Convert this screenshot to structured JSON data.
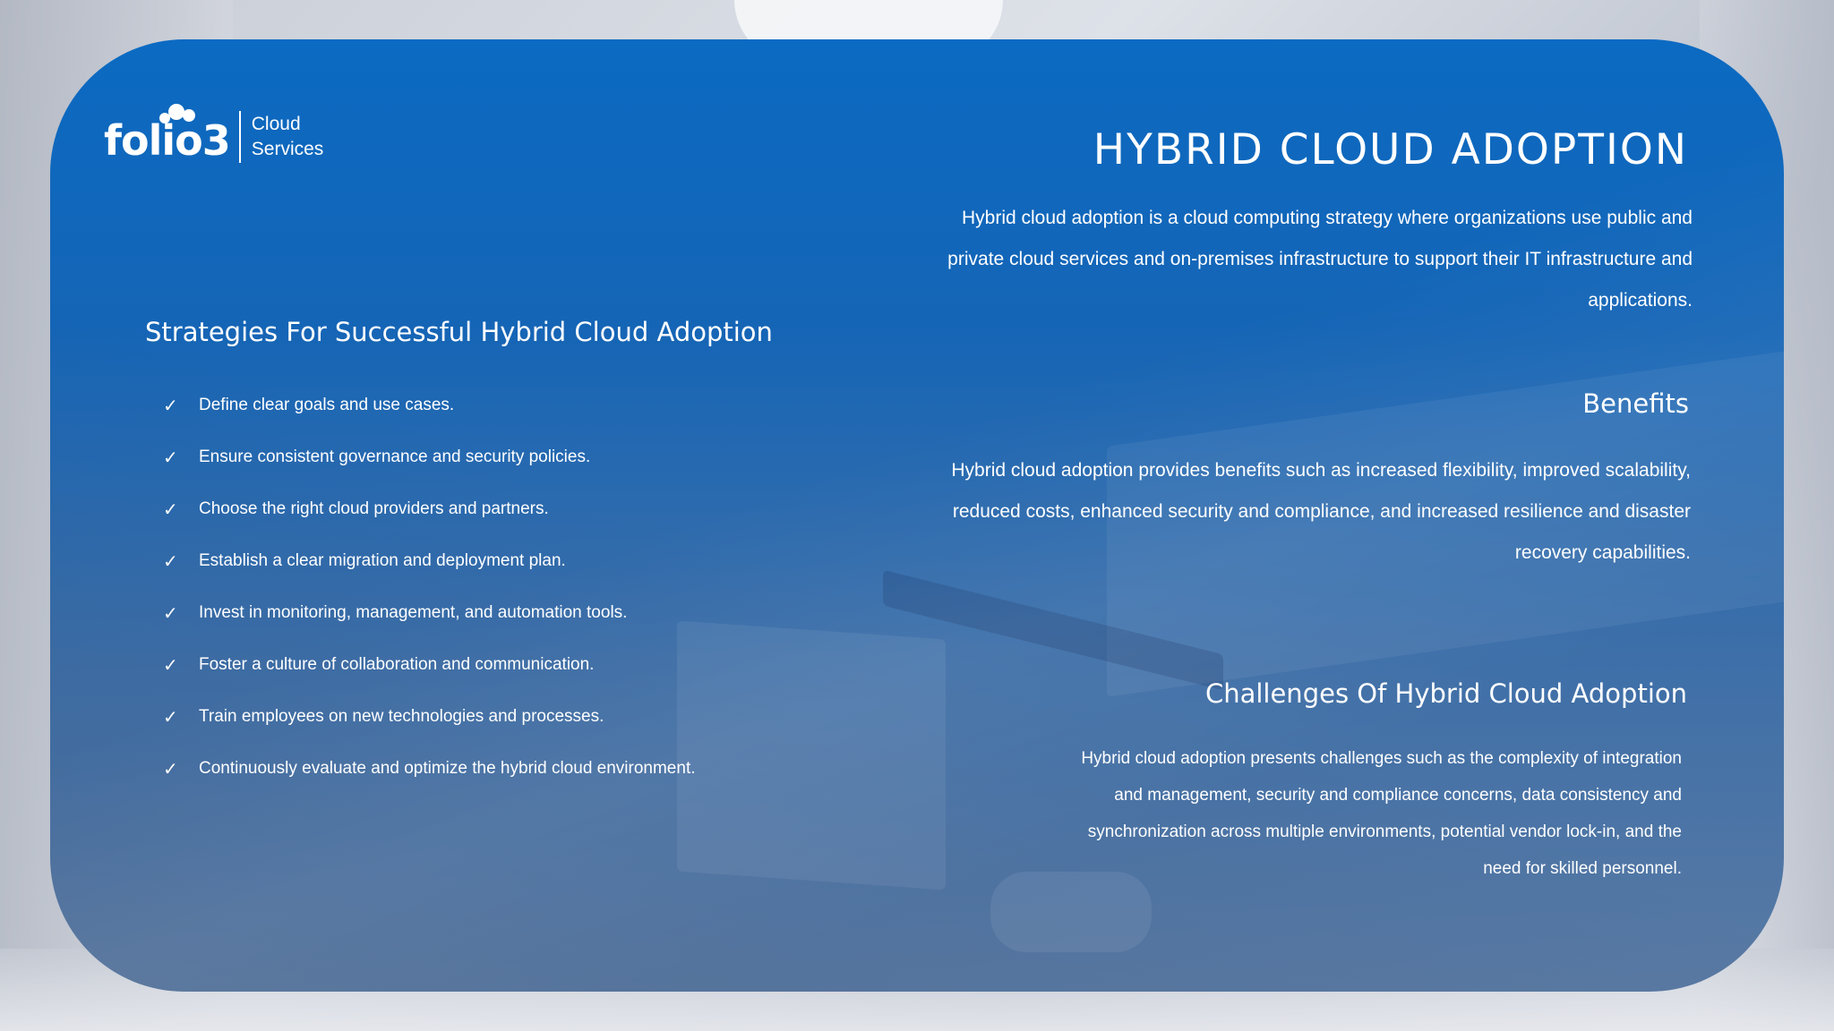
{
  "logo": {
    "brand": "folio3",
    "sub_line1": "Cloud",
    "sub_line2": "Services"
  },
  "title": "HYBRID CLOUD ADOPTION",
  "intro": "Hybrid cloud adoption is a cloud computing strategy where organizations use public and private cloud services and on-premises infrastructure to support their IT infrastructure and applications.",
  "benefits": {
    "heading": "Benefits",
    "text": "Hybrid cloud adoption provides benefits such as increased flexibility, improved scalability, reduced costs, enhanced security and compliance, and increased resilience and disaster recovery capabilities."
  },
  "challenges": {
    "heading": "Challenges Of Hybrid Cloud Adoption",
    "text": "Hybrid cloud adoption presents challenges such as the complexity of integration and management, security and compliance concerns, data consistency and synchronization across multiple environments, potential vendor lock-in, and the need for skilled personnel."
  },
  "strategies": {
    "heading": "Strategies For Successful Hybrid Cloud Adoption",
    "bullet_icon": "checkmark-icon",
    "bullet_glyph": "✓",
    "items": [
      "Define clear goals and use cases.",
      "Ensure consistent governance and security policies.",
      "Choose the right cloud providers and partners.",
      "Establish a clear migration and deployment plan.",
      "Invest in monitoring, management, and automation tools.",
      "Foster a culture of collaboration and communication.",
      "Train employees on new technologies and processes.",
      "Continuously evaluate and optimize the hybrid cloud environment."
    ]
  },
  "colors": {
    "card_top": "#0b6ac2",
    "card_bottom": "#5a7aa3",
    "text": "#ffffff"
  }
}
